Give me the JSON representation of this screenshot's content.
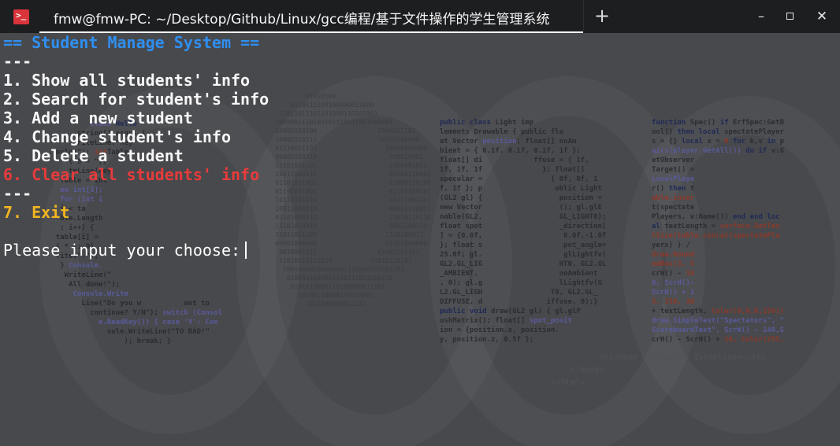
{
  "window": {
    "tab_title": "fmw@fmw-PC: ~/Desktop/Github/Linux/gcc编程/基于文件操作的学生管理系统",
    "new_tab_label": "+",
    "minimize_label": "–",
    "close_label": "✕",
    "icons": {
      "app": "terminal-app-icon",
      "new_tab": "plus-icon",
      "minimize": "minimize-icon",
      "maximize": "maximize-icon",
      "close": "close-icon"
    },
    "colors": {
      "titlebar": "#1d1e20",
      "terminal_bg": "#48494d",
      "accent_blue": "#2f8ff0",
      "accent_red": "#e83b3b",
      "accent_yellow": "#f2b521"
    }
  },
  "terminal": {
    "header": "== Student Manage System ==",
    "separator_top": "---",
    "menu": [
      "1. Show all students' info",
      "2. Search for student's info",
      "3. Add a new student",
      "4. Change student's info",
      "5. Delete a student",
      "6. Clear all students' info"
    ],
    "separator_bottom": "---",
    "exit_option": "7. Exit",
    "prompt": "Please input your choose:"
  }
}
